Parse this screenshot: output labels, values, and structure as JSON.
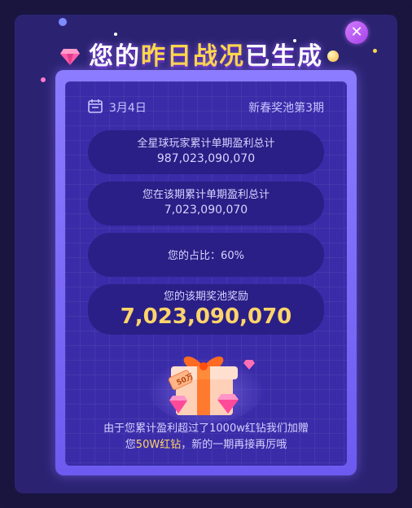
{
  "dialog": {
    "title_pre": "您的",
    "title_hl": "昨日战况",
    "title_post": "已生成",
    "close_glyph": "✕"
  },
  "header": {
    "date": "3月4日",
    "period": "新春奖池第3期"
  },
  "stats": [
    {
      "label": "全星球玩家累计单期盈利总计",
      "value": "987,023,090,070"
    },
    {
      "label": "您在该期累计单期盈利总计",
      "value": "7,023,090,070"
    },
    {
      "label": "您的占比：60%"
    },
    {
      "label": "您的该期奖池奖励",
      "value": "7,023,090,070"
    }
  ],
  "gift": {
    "tag": "50万",
    "icon": "gift-box-icon"
  },
  "footer": {
    "line1": "由于您累计盈利超过了1000w红钻我们加赠",
    "line2_pre": "您",
    "line2_hl": "50W红钻",
    "line2_post": "，新的一期再接再厉哦"
  },
  "colors": {
    "accent_gold": "#ffd46a",
    "panel": "#3a2ca8",
    "pill": "#2a1f86",
    "close": "#b84df0"
  }
}
